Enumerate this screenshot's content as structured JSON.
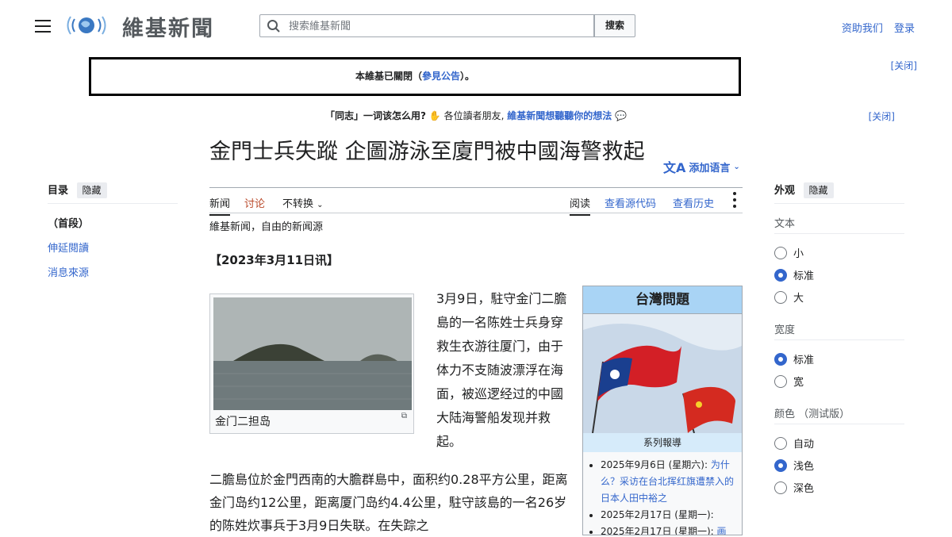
{
  "header": {
    "wordmark": "維基新聞",
    "search_placeholder": "搜索維基新聞",
    "search_button": "搜索",
    "donate": "资助我们",
    "login": "登录"
  },
  "notices": {
    "close_label": "[关闭]",
    "sitenotice_text": "本維基已關閉（",
    "sitenotice_link": "參見公告",
    "sitenotice_end": "）。",
    "survey_prefix": "「同志」一词该怎么用?",
    "survey_mid": "各位讀者朋友,",
    "survey_link": "維基新聞想聽聽你的想法"
  },
  "article": {
    "title": "金門士兵失蹤 企圖游泳至廈門被中國海警救起",
    "add_languages": "添加语言",
    "tabs_left": [
      "新闻",
      "讨论",
      "不转换"
    ],
    "tabs_right": [
      "阅读",
      "查看源代码",
      "查看历史"
    ],
    "tagline": "維基新闻，自由的新闻源",
    "lead": "【2023年3月11日讯】",
    "figure_caption": "金门二担岛",
    "para1": "3月9日，駐守金门二膽島的一名陈姓士兵身穿救生衣游往厦门，由于体力不支随波漂浮在海面，被巡逻经过的中國大陆海警船发现并救起。",
    "para2": "二膽島位於金門西南的大膽群島中，面积约0.28平方公里，距离金门岛约12公里，距离厦门岛约4.4公里，駐守該島的一名26岁的陈姓炊事兵于3月9日失联。在失踪之"
  },
  "toc": {
    "title": "目录",
    "hide": "隐藏",
    "items": [
      "（首段）",
      "伸延閱讀",
      "消息來源"
    ]
  },
  "infobox": {
    "title": "台灣問題",
    "subtitle": "系列報導",
    "items": [
      {
        "date": "2025年9月6日 (星期六):",
        "link": "为什么？采访在台北挥红旗遭禁入的日本人田中裕之"
      },
      {
        "date": "2025年2月17日 (星期一):",
        "link": ""
      },
      {
        "date": "2025年2月17日 (星期一):",
        "link": "画"
      }
    ]
  },
  "appearance": {
    "title": "外观",
    "hide": "隐藏",
    "text_label": "文本",
    "text_options": [
      "小",
      "标准",
      "大"
    ],
    "text_selected": 1,
    "width_label": "宽度",
    "width_options": [
      "标准",
      "宽"
    ],
    "width_selected": 0,
    "color_label": "颜色 （测试版）",
    "color_options": [
      "自动",
      "浅色",
      "深色"
    ],
    "color_selected": 1
  },
  "colors": {
    "link": "#3366cc",
    "infobox_header": "#a9d4f5",
    "selected_radio": "#3366cc"
  }
}
